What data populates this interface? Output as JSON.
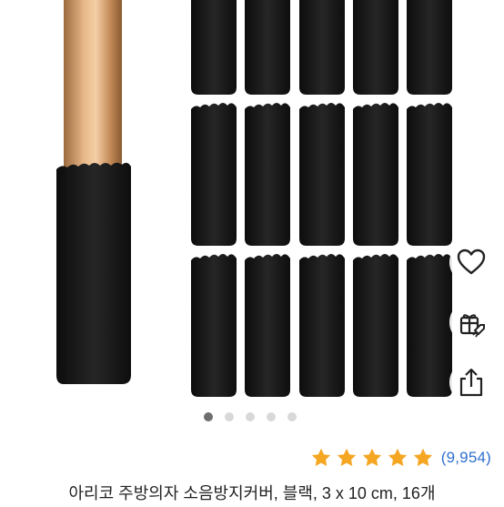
{
  "product": {
    "title": "아리코 주방의자 소음방지커버, 블랙, 3 x 10 cm, 16개",
    "rating": 5,
    "rating_max": 5,
    "review_count": "(9,954)"
  },
  "gallery": {
    "image_count": 5,
    "active_index": 0,
    "covers_shown": 15
  },
  "actions": {
    "items": [
      {
        "name": "wishlist",
        "icon": "heart-outline-icon"
      },
      {
        "name": "gift",
        "icon": "gift-rocket-icon"
      },
      {
        "name": "share",
        "icon": "share-icon"
      }
    ]
  },
  "colors": {
    "star": "#f5a623",
    "review_link": "#2f6fce",
    "title_text": "#222222",
    "cover_black": "#1a1a1a",
    "chair_leg_wood": "#c8915c"
  }
}
